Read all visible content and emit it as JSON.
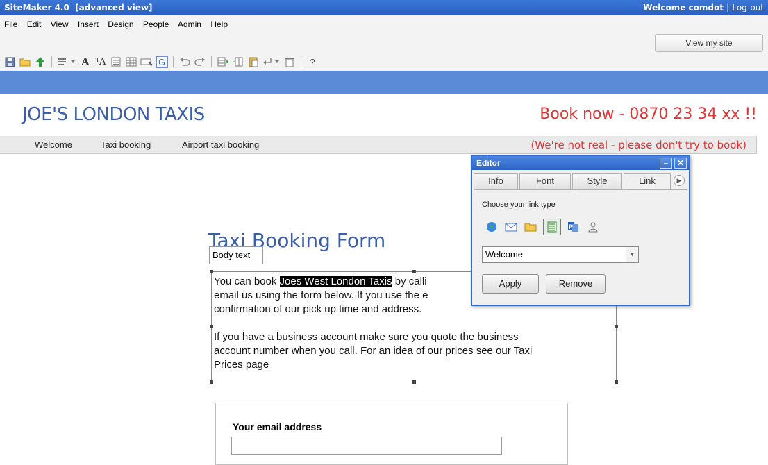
{
  "titlebar": {
    "app": "SiteMaker 4.0",
    "mode": "[advanced view]",
    "welcome": "Welcome comdot",
    "separator": "|",
    "logout": "Log-out"
  },
  "menu": [
    "File",
    "Edit",
    "View",
    "Insert",
    "Design",
    "People",
    "Admin",
    "Help"
  ],
  "view_site_label": "View my site",
  "toolbar": {
    "help": "?"
  },
  "site": {
    "title": "JOE'S LONDON TAXIS",
    "book_now": "Book now - 0870 23 34 xx !!",
    "nav": [
      "Welcome",
      "Taxi booking",
      "Airport taxi booking"
    ],
    "not_real": "(We're not real - please don't try to book)"
  },
  "page": {
    "title": "Taxi Booking Form",
    "body_label": "Body text",
    "para1_pre": "You can book ",
    "para1_highlight": "Joes West London Taxis",
    "para1_line1_post": " by calli",
    "para1_line2": "email us using the form below. If you use the e",
    "para1_line3": "confirmation of our pick up time and address.",
    "para2_line1": "If you have a business account make sure you quote the business",
    "para2_line2_pre": "account number when you call. For an idea of our prices see our ",
    "para2_link_a": "Taxi",
    "para2_link_b": "Prices",
    "para2_post": " page",
    "email_label": "Your email address"
  },
  "editor": {
    "title": "Editor",
    "minimize": "–",
    "close": "✕",
    "tabs": [
      "Info",
      "Font",
      "Style",
      "Link"
    ],
    "active_tab": "Link",
    "choose_label": "Choose your link type",
    "link_types": [
      "web-link",
      "email-link",
      "folder-link",
      "page-link",
      "document-link",
      "person-link"
    ],
    "selected_link_type": "page-link",
    "selected_page": "Welcome",
    "apply_label": "Apply",
    "remove_label": "Remove"
  },
  "colors": {
    "titlebar": "#2a5fbf",
    "band": "#5b8ad6",
    "site_title": "#3a5fa8",
    "accent_red": "#e03535"
  }
}
